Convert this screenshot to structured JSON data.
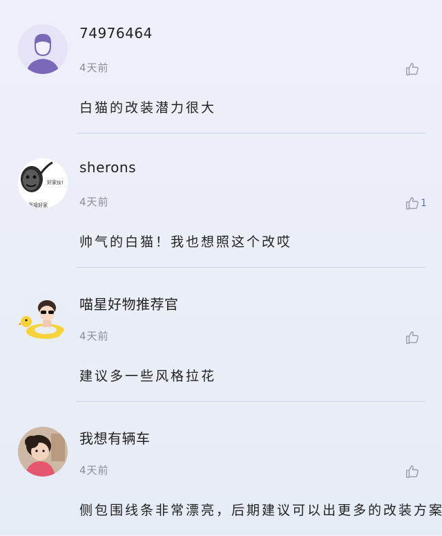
{
  "comments": [
    {
      "username": "74976464",
      "time": "4天前",
      "text": "白猫的改装潜力很大",
      "likes": "",
      "avatar_icon": "default-user-silhouette"
    },
    {
      "username": "sherons",
      "time": "4天前",
      "text": "帅气的白猫！我也想照这个改哎",
      "likes": "1",
      "avatar_icon": "meme-face",
      "avatar_caption_top": "好家伙!",
      "avatar_caption_bottom": "妈直接好家"
    },
    {
      "username": "喵星好物推荐官",
      "time": "4天前",
      "text": "建议多一些风格拉花",
      "likes": "",
      "avatar_icon": "child-with-duck-float"
    },
    {
      "username": "我想有辆车",
      "time": "4天前",
      "text": "侧包围线条非常漂亮，后期建议可以出更多的改装方案",
      "likes": "",
      "avatar_icon": "little-girl-photo"
    }
  ],
  "colors": {
    "like_icon": "#9aa0ad",
    "accent": "#5a73c8",
    "divider": "#c9d3e6"
  }
}
